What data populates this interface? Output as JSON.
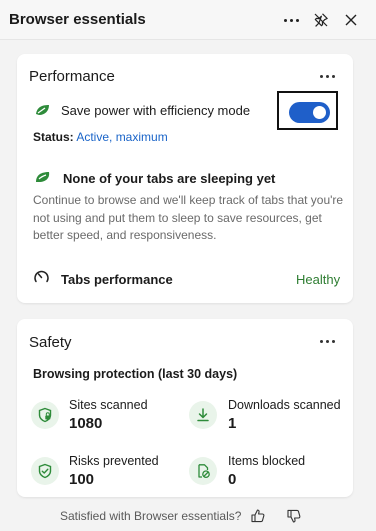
{
  "app": {
    "title": "Browser essentials"
  },
  "header": {
    "icons": [
      "more-icon",
      "unpin-icon",
      "close-icon"
    ]
  },
  "performance": {
    "title": "Performance",
    "efficiency_label": "Save power with efficiency mode",
    "efficiency_enabled": true,
    "status_label": "Status:",
    "status_value": "Active, maximum",
    "sleeping_heading": "None of your tabs are sleeping yet",
    "sleeping_desc": "Continue to browse and we'll keep track of tabs that you're not using and put them to sleep to save resources, get better speed, and responsiveness.",
    "tabs_performance_label": "Tabs performance",
    "tabs_performance_value": "Healthy"
  },
  "safety": {
    "title": "Safety",
    "subtitle": "Browsing protection (last 30 days)",
    "stats": [
      {
        "label": "Sites scanned",
        "value": "1080",
        "icon": "shield-lock-icon"
      },
      {
        "label": "Downloads scanned",
        "value": "1",
        "icon": "download-icon"
      },
      {
        "label": "Risks prevented",
        "value": "100",
        "icon": "shield-check-icon"
      },
      {
        "label": "Items blocked",
        "value": "0",
        "icon": "blocked-document-icon"
      }
    ]
  },
  "footer": {
    "question": "Satisfied with Browser essentials?"
  },
  "colors": {
    "accent": "#1f5fc9",
    "link": "#1a64c8",
    "healthy": "#2e7d32",
    "icon_green": "#2e8b3a"
  }
}
